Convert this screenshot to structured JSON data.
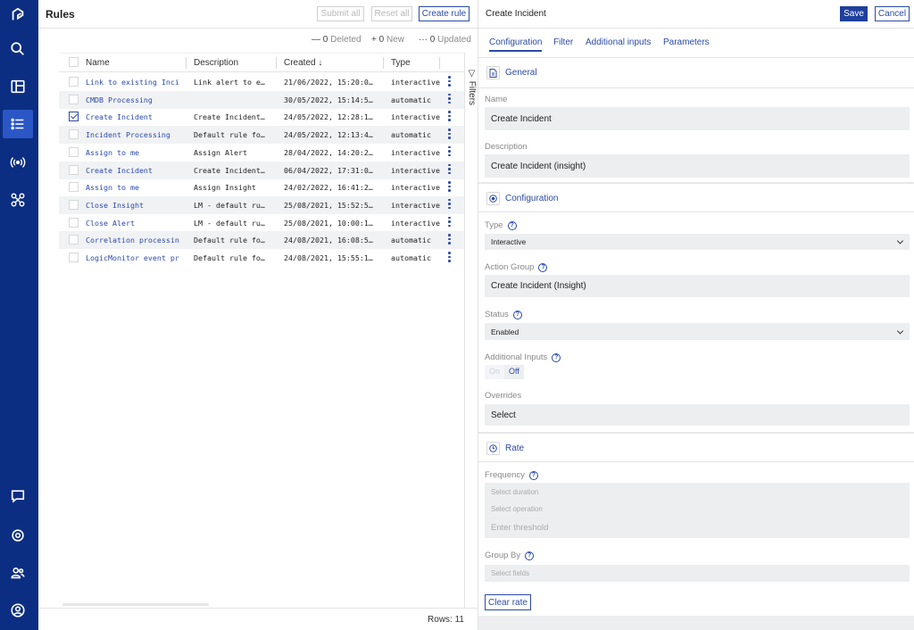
{
  "sidenav": {
    "icons": [
      "logo-icon",
      "search-icon",
      "dashboard-icon",
      "list-icon",
      "broadcast-icon",
      "integrations-icon",
      "chat-icon",
      "settings-icon",
      "users-icon",
      "profile-icon"
    ],
    "accent": "#0c2e82"
  },
  "rules": {
    "title": "Rules",
    "submit_all": "Submit all",
    "reset_all": "Reset all",
    "create_rule": "Create rule",
    "counts": {
      "deleted_prefix": "— ",
      "deleted_value": "0",
      "deleted_label": "Deleted",
      "new_prefix": "+ ",
      "new_value": "0",
      "new_label": "New",
      "updated_prefix": "··· ",
      "updated_value": "0",
      "updated_label": "Updated"
    },
    "columns": {
      "name": "Name",
      "description": "Description",
      "created": "Created ↓",
      "type": "Type"
    },
    "rows": [
      {
        "name": "Link to existing Inci",
        "description": "Link alert to e…",
        "created": "21/06/2022, 15:20:0…",
        "type": "interactive"
      },
      {
        "name": "CMDB Processing",
        "description": "",
        "created": "30/05/2022, 15:14:5…",
        "type": "automatic"
      },
      {
        "name": "Create Incident",
        "description": "Create Incident…",
        "created": "24/05/2022, 12:28:1…",
        "type": "interactive"
      },
      {
        "name": "Incident Processing",
        "description": "Default rule fo…",
        "created": "24/05/2022, 12:13:4…",
        "type": "automatic"
      },
      {
        "name": "Assign to me",
        "description": "Assign Alert",
        "created": "28/04/2022, 14:20:2…",
        "type": "interactive"
      },
      {
        "name": "Create Incident",
        "description": "Create Incident…",
        "created": "06/04/2022, 17:31:0…",
        "type": "interactive"
      },
      {
        "name": "Assign to me",
        "description": "Assign Insight",
        "created": "24/02/2022, 16:41:2…",
        "type": "interactive"
      },
      {
        "name": "Close Insight",
        "description": "LM - default ru…",
        "created": "25/08/2021, 15:52:5…",
        "type": "interactive"
      },
      {
        "name": "Close Alert",
        "description": "LM - default ru…",
        "created": "25/08/2021, 10:00:1…",
        "type": "interactive"
      },
      {
        "name": "Correlation processin",
        "description": "Default rule fo…",
        "created": "24/08/2021, 16:08:5…",
        "type": "automatic"
      },
      {
        "name": "LogicMonitor event pr",
        "description": "Default rule fo…",
        "created": "24/08/2021, 15:55:1…",
        "type": "automatic"
      }
    ],
    "filters_label": "Filters",
    "rows_label": "Rows: 11"
  },
  "detail": {
    "title": "Create Incident",
    "save": "Save",
    "cancel": "Cancel",
    "tabs": [
      "Configuration",
      "Filter",
      "Additional inputs",
      "Parameters"
    ],
    "general": {
      "title": "General",
      "name_label": "Name",
      "name_value": "Create Incident",
      "description_label": "Description",
      "description_value": "Create Incident (insight)"
    },
    "configuration": {
      "title": "Configuration",
      "type_label": "Type",
      "type_value": "Interactive",
      "action_group_label": "Action Group",
      "action_group_value": "Create Incident (Insight)",
      "status_label": "Status",
      "status_value": "Enabled",
      "additional_inputs_label": "Additional Inputs",
      "toggle_on": "On",
      "toggle_off": "Off",
      "overrides_label": "Overrides",
      "overrides_value": "Select"
    },
    "rate": {
      "title": "Rate",
      "frequency_label": "Frequency",
      "duration_placeholder": "Select duration",
      "operation_placeholder": "Select operation",
      "threshold_placeholder": "Enter threshold",
      "group_by_label": "Group By",
      "fields_placeholder": "Select fields",
      "clear_rate": "Clear rate"
    }
  }
}
